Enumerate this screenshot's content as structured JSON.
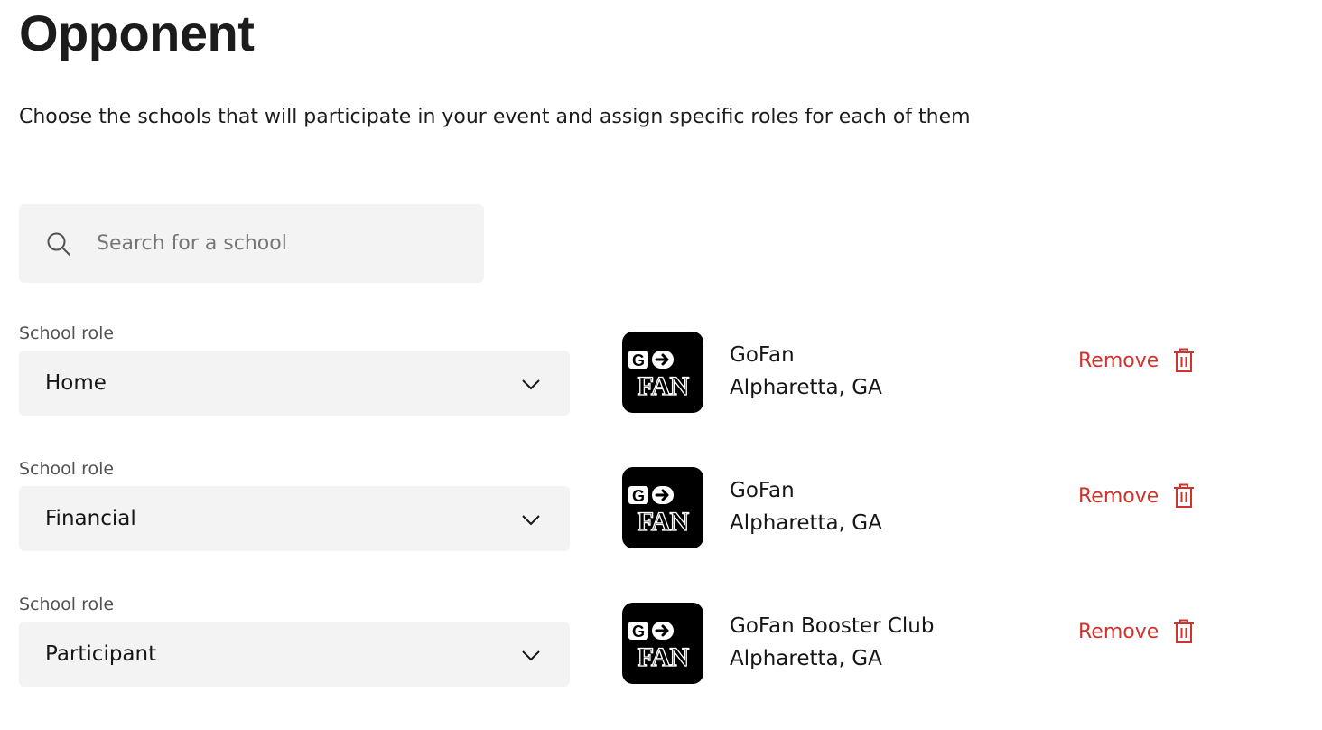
{
  "page": {
    "title": "Opponent",
    "description": "Choose the schools that will participate in your event and assign specific roles for each of them"
  },
  "search": {
    "placeholder": "Search for a school",
    "value": ""
  },
  "schools": [
    {
      "role_label": "School role",
      "role": "Home",
      "name": "GoFan",
      "location": "Alpharetta, GA",
      "remove_label": "Remove",
      "logo_icon": "gofan-logo"
    },
    {
      "role_label": "School role",
      "role": "Financial",
      "name": "GoFan",
      "location": "Alpharetta, GA",
      "remove_label": "Remove",
      "logo_icon": "gofan-logo"
    },
    {
      "role_label": "School role",
      "role": "Participant",
      "name": "GoFan Booster Club",
      "location": "Alpharetta, GA",
      "remove_label": "Remove",
      "logo_icon": "gofan-logo"
    }
  ],
  "colors": {
    "remove": "#d0332b",
    "field_bg": "#f3f3f3",
    "logo_bg": "#000000"
  }
}
